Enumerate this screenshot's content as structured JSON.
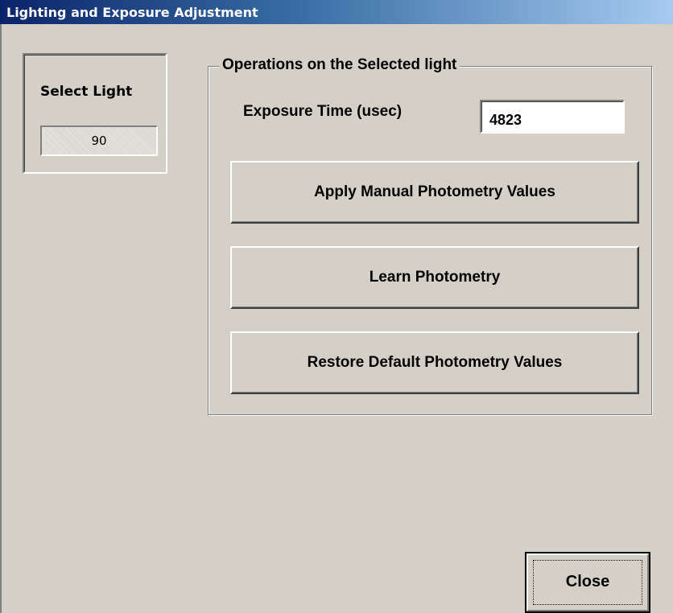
{
  "window": {
    "title": "Lighting and Exposure Adjustment"
  },
  "select_light": {
    "label": "Select Light",
    "value": "90"
  },
  "operations": {
    "group_title": "Operations on the Selected light",
    "exposure_label": "Exposure Time (usec)",
    "exposure_value": "4823",
    "apply_button": "Apply Manual Photometry Values",
    "learn_button": "Learn Photometry",
    "restore_button": "Restore Default Photometry Values"
  },
  "footer": {
    "close_button": "Close"
  },
  "colors": {
    "face": "#d4d0c8",
    "title_start": "#0a246a",
    "title_end": "#a6caf0"
  }
}
